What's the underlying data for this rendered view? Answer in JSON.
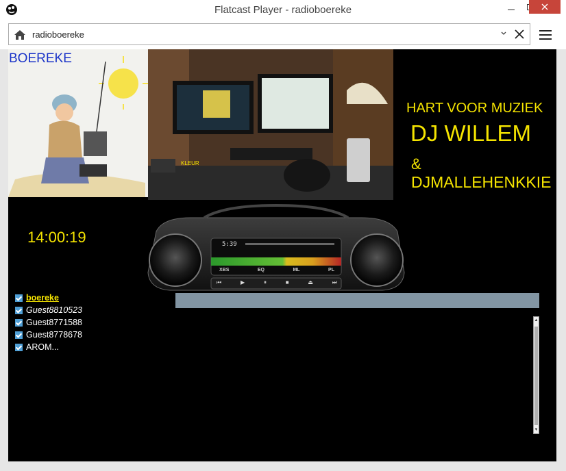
{
  "window": {
    "title": "Flatcast Player - radioboereke"
  },
  "address_bar": {
    "value": "radioboereke"
  },
  "banner": {
    "logo_text": "BOEREKE",
    "photo_caption": "KLEUR",
    "tagline": "HART VOOR MUZIEK",
    "dj_primary": "DJ WILLEM",
    "ampersand": "&",
    "dj_secondary": "DJMALLEHENKKIE"
  },
  "clock": "14:00:19",
  "player": {
    "track_time": "5:39",
    "buttons": [
      "XBS",
      "EQ",
      "ML",
      "PL"
    ]
  },
  "users": [
    {
      "name": "boereke"
    },
    {
      "name": "Guest8810523"
    },
    {
      "name": "Guest8771588"
    },
    {
      "name": "Guest8778678"
    },
    {
      "name": "AROM..."
    }
  ],
  "colors": {
    "accent_yellow": "#f5e400",
    "logo_blue": "#1a33c8",
    "chat_bar": "#8295a3"
  }
}
